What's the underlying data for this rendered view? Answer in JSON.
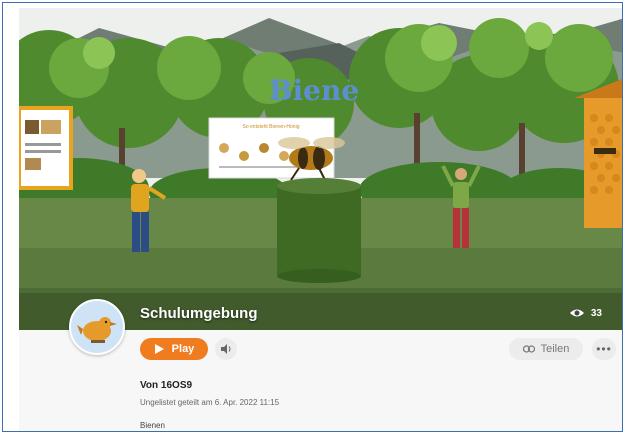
{
  "scene": {
    "heading": "Biene",
    "board_title": "So entsteht Bienen-Honig"
  },
  "world": {
    "title": "Schulumgebung",
    "view_count": "33"
  },
  "actions": {
    "play_label": "Play",
    "share_label": "Teilen",
    "more_label": "•••"
  },
  "details": {
    "author": "Von 16OS9",
    "shared_text": "Ungelistet geteilt am 6. Apr. 2022 11:15",
    "tag": "Bienen"
  },
  "colors": {
    "accent": "#f07c20",
    "heading": "#5d8fd0"
  }
}
